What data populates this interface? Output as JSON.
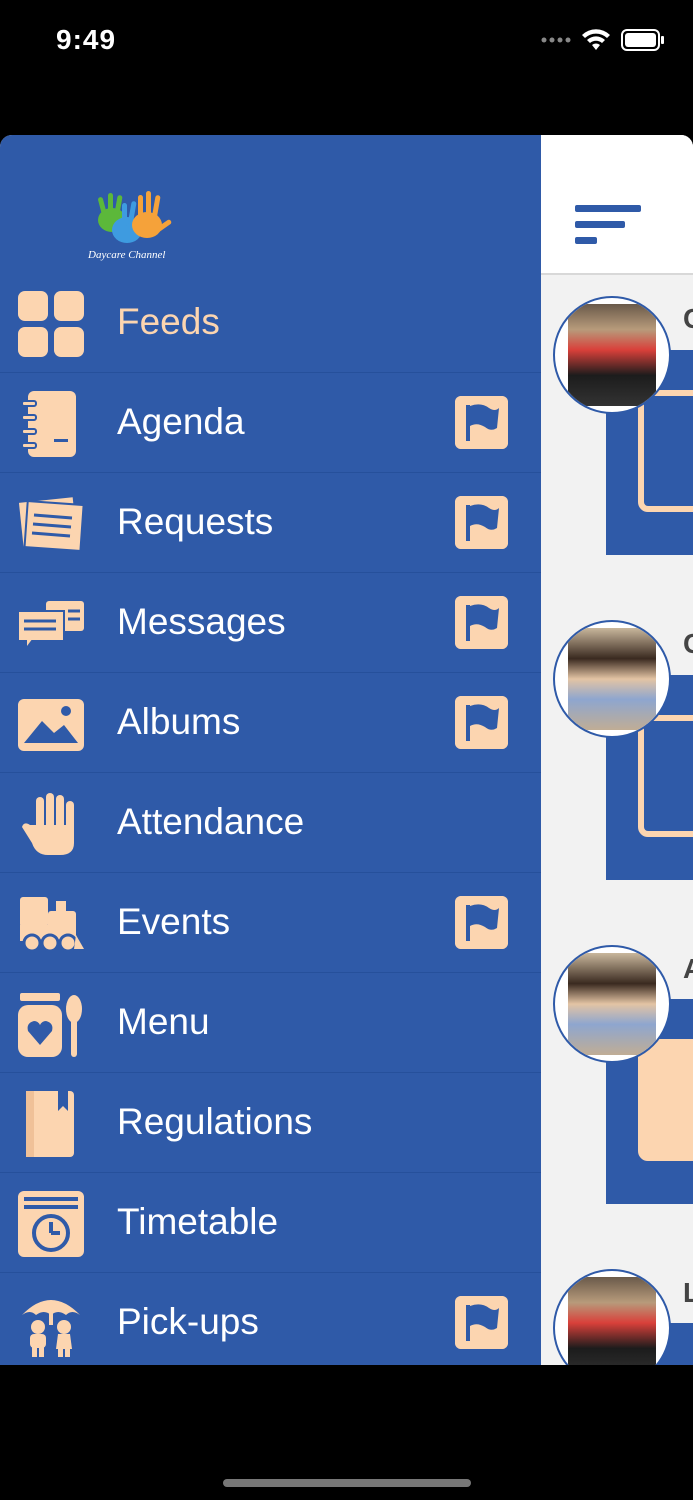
{
  "status_bar": {
    "time": "9:49"
  },
  "drawer": {
    "logo_text": "Daycare Channel",
    "items": [
      {
        "label": "Feeds",
        "icon": "grid-icon",
        "flag": false,
        "active": true
      },
      {
        "label": "Agenda",
        "icon": "notebook-icon",
        "flag": true
      },
      {
        "label": "Requests",
        "icon": "papers-icon",
        "flag": true
      },
      {
        "label": "Messages",
        "icon": "chat-bubbles-icon",
        "flag": true
      },
      {
        "label": "Albums",
        "icon": "photo-icon",
        "flag": true
      },
      {
        "label": "Attendance",
        "icon": "hand-icon",
        "flag": false
      },
      {
        "label": "Events",
        "icon": "toy-train-icon",
        "flag": true
      },
      {
        "label": "Menu",
        "icon": "jar-spoon-icon",
        "flag": false
      },
      {
        "label": "Regulations",
        "icon": "book-icon",
        "flag": false
      },
      {
        "label": "Timetable",
        "icon": "calendar-clock-icon",
        "flag": false
      },
      {
        "label": "Pick-ups",
        "icon": "umbrella-kids-icon",
        "flag": true
      }
    ]
  },
  "feed": {
    "cards": [
      {
        "letter": "C"
      },
      {
        "letter": "C"
      },
      {
        "letter": "A"
      },
      {
        "letter": "L"
      }
    ]
  },
  "colors": {
    "primary": "#2f5aa8",
    "accent": "#fcd5b0"
  }
}
